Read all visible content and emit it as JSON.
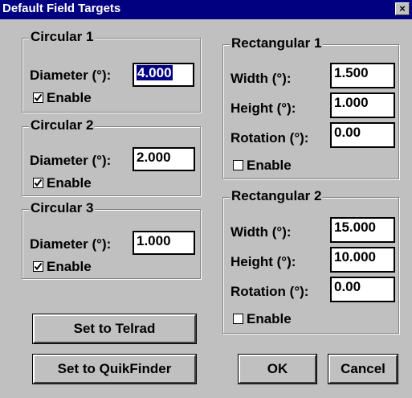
{
  "window": {
    "title": "Default Field Targets",
    "close_glyph": "×"
  },
  "circular": [
    {
      "title": "Circular 1",
      "diameter_label": "Diameter (°):",
      "diameter_value": "4.000",
      "enable_label": "Enable",
      "enabled": true
    },
    {
      "title": "Circular 2",
      "diameter_label": "Diameter (°):",
      "diameter_value": "2.000",
      "enable_label": "Enable",
      "enabled": true
    },
    {
      "title": "Circular 3",
      "diameter_label": "Diameter (°):",
      "diameter_value": "1.000",
      "enable_label": "Enable",
      "enabled": true
    }
  ],
  "rectangular": [
    {
      "title": "Rectangular 1",
      "width_label": "Width (°):",
      "width_value": "1.500",
      "height_label": "Height (°):",
      "height_value": "1.000",
      "rotation_label": "Rotation (°):",
      "rotation_value": "0.00",
      "enable_label": "Enable",
      "enabled": false
    },
    {
      "title": "Rectangular 2",
      "width_label": "Width (°):",
      "width_value": "15.000",
      "height_label": "Height (°):",
      "height_value": "10.000",
      "rotation_label": "Rotation (°):",
      "rotation_value": "0.00",
      "enable_label": "Enable",
      "enabled": false
    }
  ],
  "buttons": {
    "telrad": "Set to Telrad",
    "quikfinder": "Set to QuikFinder",
    "ok": "OK",
    "cancel": "Cancel"
  },
  "colors": {
    "face": "#c0c0c0",
    "titlebar": "#000080",
    "selection": "#000080"
  }
}
